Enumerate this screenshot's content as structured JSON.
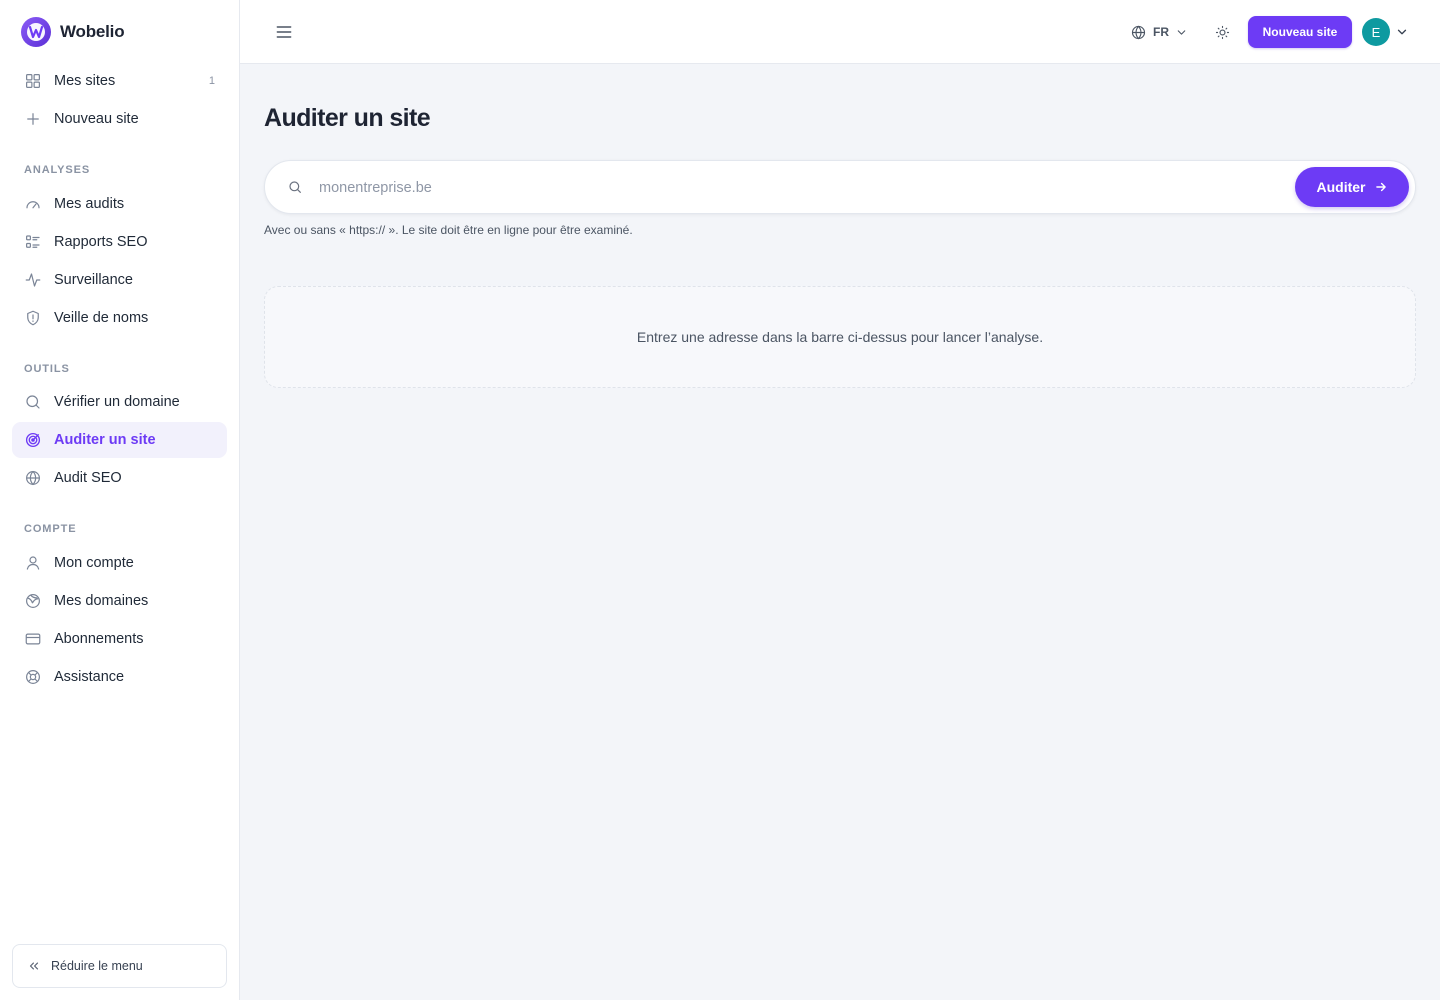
{
  "brand": {
    "name": "Wobelio"
  },
  "sidebar": {
    "top_items": [
      {
        "label": "Mes sites",
        "icon": "grid-icon",
        "count": "1"
      },
      {
        "label": "Nouveau site",
        "icon": "plus-icon"
      }
    ],
    "sections": [
      {
        "title": "ANALYSES",
        "items": [
          {
            "label": "Mes audits",
            "icon": "gauge-icon"
          },
          {
            "label": "Rapports SEO",
            "icon": "list-check-icon"
          },
          {
            "label": "Surveillance",
            "icon": "activity-icon"
          },
          {
            "label": "Veille de noms",
            "icon": "shield-alert-icon"
          }
        ]
      },
      {
        "title": "OUTILS",
        "items": [
          {
            "label": "Vérifier un domaine",
            "icon": "search-icon"
          },
          {
            "label": "Auditer un site",
            "icon": "target-icon",
            "active": true
          },
          {
            "label": "Audit SEO",
            "icon": "globe-icon"
          }
        ]
      },
      {
        "title": "COMPTE",
        "items": [
          {
            "label": "Mon compte",
            "icon": "user-icon"
          },
          {
            "label": "Mes domaines",
            "icon": "globe-grid-icon"
          },
          {
            "label": "Abonnements",
            "icon": "credit-card-icon"
          },
          {
            "label": "Assistance",
            "icon": "lifebuoy-icon"
          }
        ]
      }
    ],
    "collapse_label": "Réduire le menu"
  },
  "topbar": {
    "language": "FR",
    "new_site_label": "Nouveau site",
    "avatar_initial": "E",
    "avatar_color": "#0e9aa0"
  },
  "main": {
    "title": "Auditer un site",
    "search": {
      "placeholder": "monentreprise.be",
      "value": "",
      "button_label": "Auditer"
    },
    "hint": "Avec ou sans « https:// ». Le site doit être en ligne pour être examiné.",
    "empty_message": "Entrez une adresse dans la barre ci-dessus pour lancer l’analyse."
  },
  "colors": {
    "accent": "#6d3bf5",
    "active_bg": "#f2f1fc",
    "page_bg": "#f3f5f9"
  }
}
